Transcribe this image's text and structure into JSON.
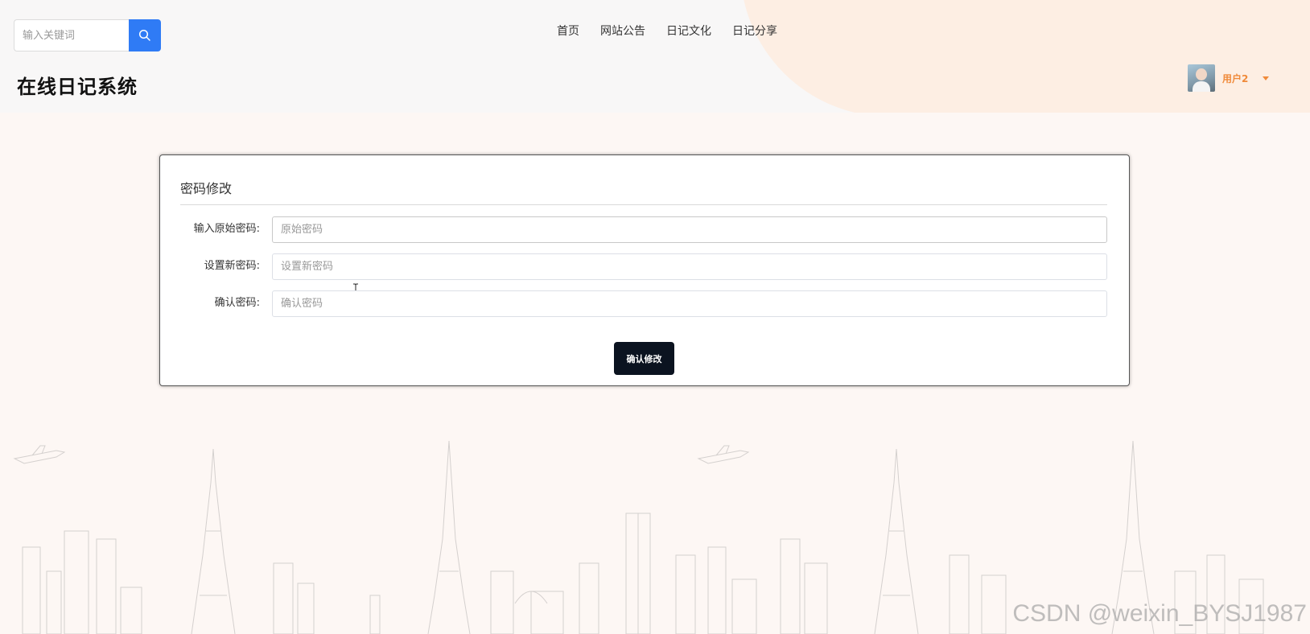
{
  "header": {
    "search_placeholder": "输入关键词",
    "site_title": "在线日记系统",
    "nav": [
      {
        "label": "首页"
      },
      {
        "label": "网站公告"
      },
      {
        "label": "日记文化"
      },
      {
        "label": "日记分享"
      }
    ],
    "user": {
      "name": "用户2"
    }
  },
  "form": {
    "title": "密码修改",
    "fields": [
      {
        "label": "输入原始密码:",
        "placeholder": "原始密码",
        "value": ""
      },
      {
        "label": "设置新密码:",
        "placeholder": "设置新密码",
        "value": ""
      },
      {
        "label": "确认密码:",
        "placeholder": "确认密码",
        "value": ""
      }
    ],
    "submit_label": "确认修改"
  },
  "watermark": "CSDN @weixin_BYSJ1987",
  "colors": {
    "primary_blue": "#2f7bf5",
    "accent_orange": "#f08a3a",
    "button_dark": "#0b1320",
    "page_bg": "#fdf7f4",
    "header_bg": "#f8f7f7"
  },
  "icons": {
    "search": "search-icon",
    "caret": "caret-down-icon",
    "cursor": "text-cursor-icon"
  }
}
